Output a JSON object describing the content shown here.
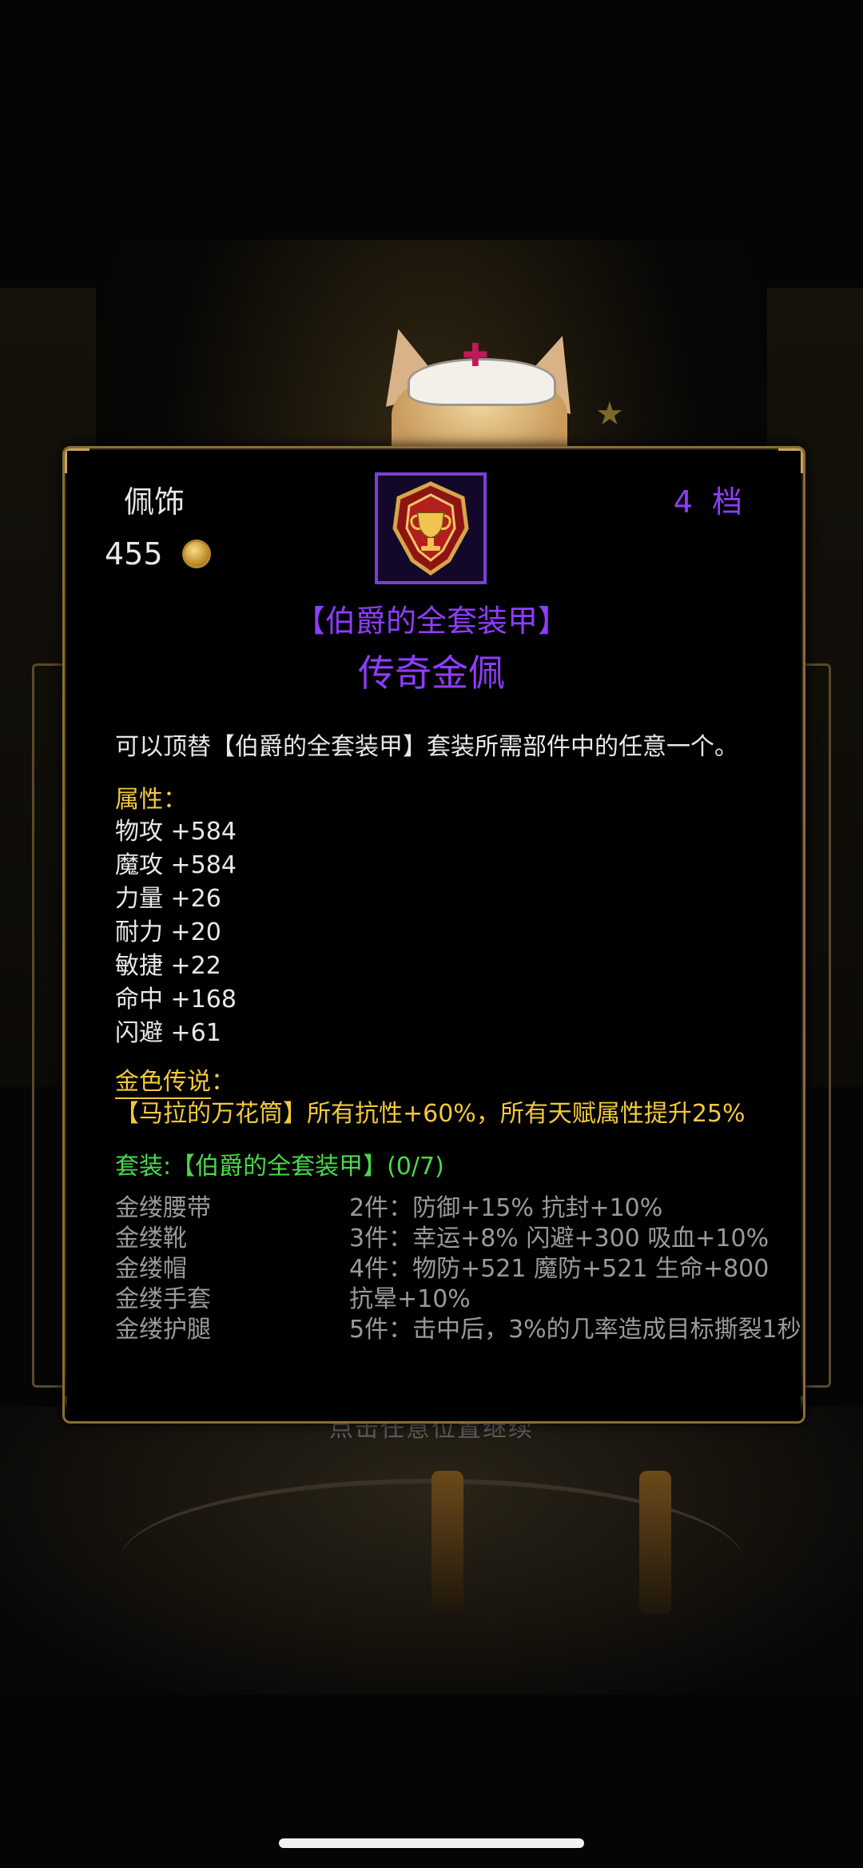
{
  "background": {
    "continue_hint": "点击任意位置继续"
  },
  "item": {
    "slot_type": "佩饰",
    "price": "455",
    "tier": "4 档",
    "set_title": "【伯爵的全套装甲】",
    "name": "传奇金佩",
    "description": "可以顶替【伯爵的全套装甲】套装所需部件中的任意一个。",
    "attributes_header": "属性：",
    "attributes": [
      "物攻 +584",
      "魔攻 +584",
      "力量 +26",
      "耐力 +20",
      "敏捷 +22",
      "命中 +168",
      "闪避 +61"
    ],
    "legend_header": "金色传说",
    "legend_colon": "：",
    "legend_text": "【马拉的万花筒】所有抗性+60%，所有天赋属性提升25%",
    "set_header": "套装:【伯爵的全套装甲】(0/7)",
    "set_pieces": [
      "金缕腰带",
      "金缕靴",
      "金缕帽",
      "金缕手套",
      "金缕护腿"
    ],
    "set_bonuses": [
      "2件：防御+15% 抗封+10%",
      "3件：幸运+8% 闪避+300 吸血+10%",
      "4件：物防+521 魔防+521 生命+800",
      "抗晕+10%",
      "5件：击中后，3%的几率造成目标撕裂1秒"
    ],
    "icons": {
      "coin": "gold-coin-icon",
      "item": "trophy-emblem-icon"
    },
    "colors": {
      "purple": "#8f3cff",
      "gold": "#f3c93a",
      "green": "#49d84a",
      "gray": "#9a9a9a"
    }
  }
}
